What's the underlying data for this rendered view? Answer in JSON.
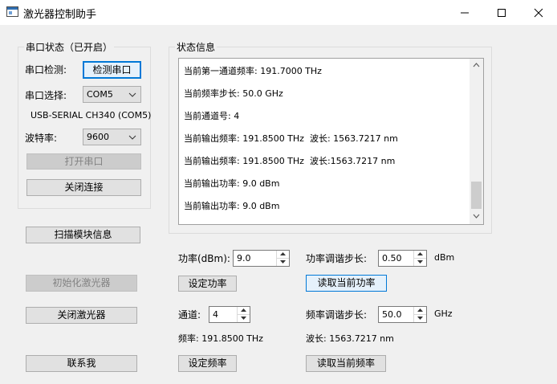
{
  "window": {
    "title": "激光器控制助手"
  },
  "serial": {
    "group_title": "串口状态（已开启）",
    "detect_label": "串口检测:",
    "detect_button": "检测串口",
    "select_label": "串口选择:",
    "port_value": "COM5",
    "port_desc": "USB-SERIAL CH340 (COM5)",
    "baud_label": "波特率:",
    "baud_value": "9600",
    "open_button": "打开串口",
    "close_button": "关闭连接"
  },
  "left_buttons": {
    "scan": "扫描模块信息",
    "init": "初始化激光器",
    "shutdown": "关闭激光器",
    "contact": "联系我"
  },
  "status": {
    "group_title": "状态信息",
    "lines": [
      "当前第一通道频率: 191.7000 THz",
      "当前频率步长: 50.0 GHz",
      "当前通道号: 4",
      "当前输出频率: 191.8500 THz  波长: 1563.7217 nm",
      "当前输出频率: 191.8500 THz  波长:1563.7217 nm",
      "当前输出功率: 9.0 dBm",
      "当前输出功率: 9.0 dBm"
    ]
  },
  "power": {
    "label": "功率(dBm):",
    "value": "9.0",
    "step_label": "功率调谐步长:",
    "step_value": "0.50",
    "step_unit": "dBm",
    "set_button": "设定功率",
    "read_button": "读取当前功率"
  },
  "channel": {
    "label": "通道:",
    "value": "4",
    "step_label": "频率调谐步长:",
    "step_value": "50.0",
    "step_unit": "GHz",
    "freq_text": "频率: 191.8500 THz",
    "wavelength_text": "波长: 1563.7217 nm",
    "set_button": "设定频率",
    "read_button": "读取当前频率"
  }
}
